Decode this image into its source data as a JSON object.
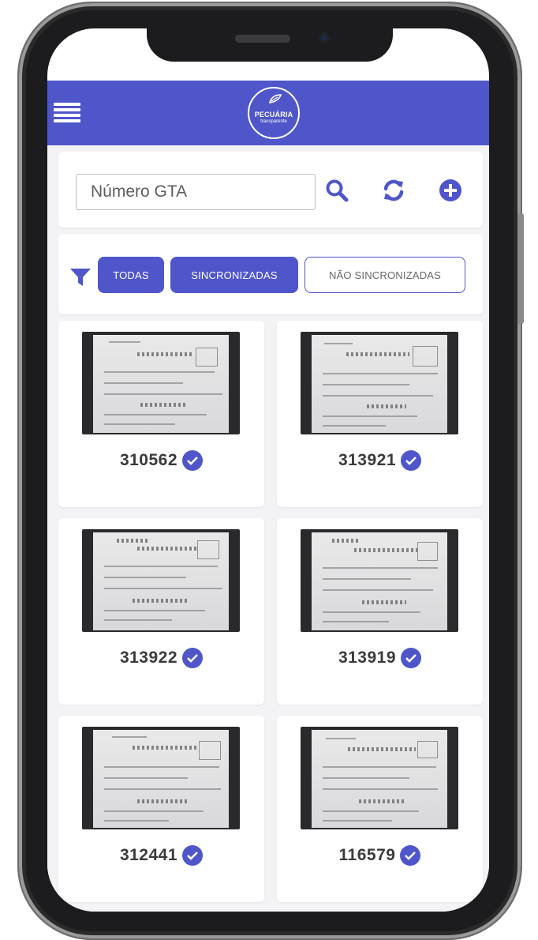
{
  "app": {
    "logo_text": "PECUÁRIA",
    "logo_subtext": "transparente"
  },
  "search": {
    "placeholder": "Número GTA",
    "value": ""
  },
  "icons": {
    "menu": "hamburger-menu-icon",
    "search": "search-icon",
    "sync": "sync-icon",
    "add": "add-circle-icon",
    "filter": "filter-icon",
    "synced": "check-circle-icon"
  },
  "filters": {
    "options": [
      {
        "label": "TODAS",
        "active": true
      },
      {
        "label": "SINCRONIZADAS",
        "active": true
      },
      {
        "label": "NÃO SINCRONIZADAS",
        "active": false
      }
    ]
  },
  "colors": {
    "brand": "#4f56c9",
    "background": "#f3f3f5"
  },
  "documents": [
    {
      "number": "310562",
      "synced": true
    },
    {
      "number": "313921",
      "synced": true
    },
    {
      "number": "313922",
      "synced": true
    },
    {
      "number": "313919",
      "synced": true
    },
    {
      "number": "312441",
      "synced": true
    },
    {
      "number": "116579",
      "synced": true
    }
  ]
}
